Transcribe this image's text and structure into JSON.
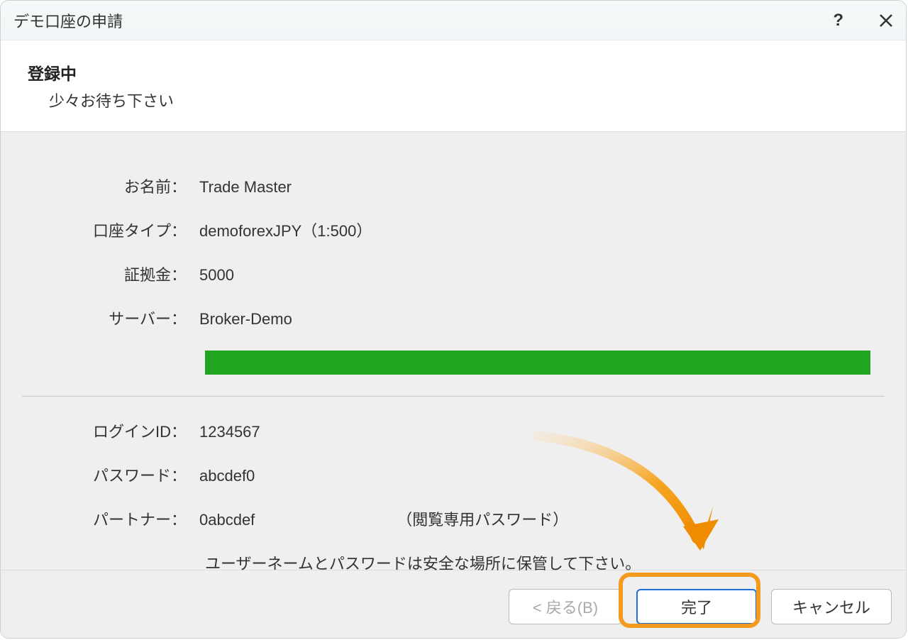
{
  "titlebar": {
    "title": "デモ口座の申請"
  },
  "header": {
    "title": "登録中",
    "subtitle": "少々お待ち下さい"
  },
  "fields": {
    "name_label": "お名前：",
    "name_value": "Trade Master",
    "account_type_label": "口座タイプ：",
    "account_type_value": "demoforexJPY（1:500）",
    "deposit_label": "証拠金：",
    "deposit_value": "5000",
    "server_label": "サーバー：",
    "server_value": "Broker-Demo",
    "login_label": "ログインID：",
    "login_value": "1234567",
    "password_label": "パスワード：",
    "password_value": "abcdef0",
    "partner_label": "パートナー：",
    "partner_value": "0abcdef",
    "partner_note": "（閲覧専用パスワード）",
    "save_note": "ユーザーネームとパスワードは安全な場所に保管して下さい。"
  },
  "footer": {
    "back_label": "< 戻る(B)",
    "finish_label": "完了",
    "cancel_label": "キャンセル"
  }
}
